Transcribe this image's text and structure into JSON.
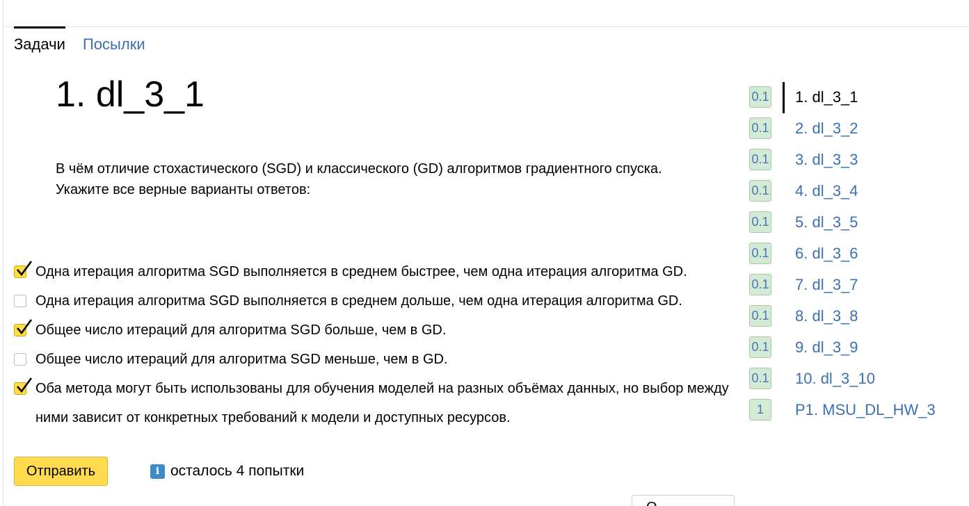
{
  "tabs": [
    {
      "label": "Задачи",
      "active": true
    },
    {
      "label": "Посылки",
      "active": false
    }
  ],
  "problem": {
    "title": "1. dl_3_1",
    "statement_line1": "В чём отличие стохастического (SGD) и классического (GD) алгоритмов градиентного спуска.",
    "statement_line2": "Укажите все верные варианты ответов:"
  },
  "options": [
    {
      "text": "Одна итерация алгоритма SGD выполняется в среднем быстрее, чем одна итерация алгоритма GD.",
      "checked": true
    },
    {
      "text": "Одна итерация алгоритма SGD выполняется в среднем дольше, чем одна итерация алгоритма GD.",
      "checked": false
    },
    {
      "text": "Общее число итераций для алгоритма SGD больше, чем в GD.",
      "checked": true
    },
    {
      "text": "Общее число итераций для алгоритма SGD меньше, чем в GD.",
      "checked": false
    },
    {
      "text": "Оба метода могут быть использованы для обучения моделей на разных объёмах данных, но выбор между ними зависит от конкретных требований к модели и доступных ресурсов.",
      "checked": true
    }
  ],
  "submit": {
    "label": "Отправить",
    "attempts_text": "осталось 4 попытки",
    "info_icon": "info-icon"
  },
  "bottom_button": {
    "label": "О..."
  },
  "sidebar": {
    "items": [
      {
        "score": "0.1",
        "label": "1. dl_3_1",
        "active": true
      },
      {
        "score": "0.1",
        "label": "2. dl_3_2",
        "active": false
      },
      {
        "score": "0.1",
        "label": "3. dl_3_3",
        "active": false
      },
      {
        "score": "0.1",
        "label": "4. dl_3_4",
        "active": false
      },
      {
        "score": "0.1",
        "label": "5. dl_3_5",
        "active": false
      },
      {
        "score": "0.1",
        "label": "6. dl_3_6",
        "active": false
      },
      {
        "score": "0.1",
        "label": "7. dl_3_7",
        "active": false
      },
      {
        "score": "0.1",
        "label": "8. dl_3_8",
        "active": false
      },
      {
        "score": "0.1",
        "label": "9. dl_3_9",
        "active": false
      },
      {
        "score": "0.1",
        "label": "10. dl_3_10",
        "active": false
      },
      {
        "score": "1",
        "label": "P1. MSU_DL_HW_3",
        "active": false
      }
    ]
  },
  "colors": {
    "accent_yellow": "#ffdb4d",
    "link_blue": "#3b6fb6",
    "score_green_bg": "#d5ead4",
    "info_blue": "#3e8bc5"
  }
}
